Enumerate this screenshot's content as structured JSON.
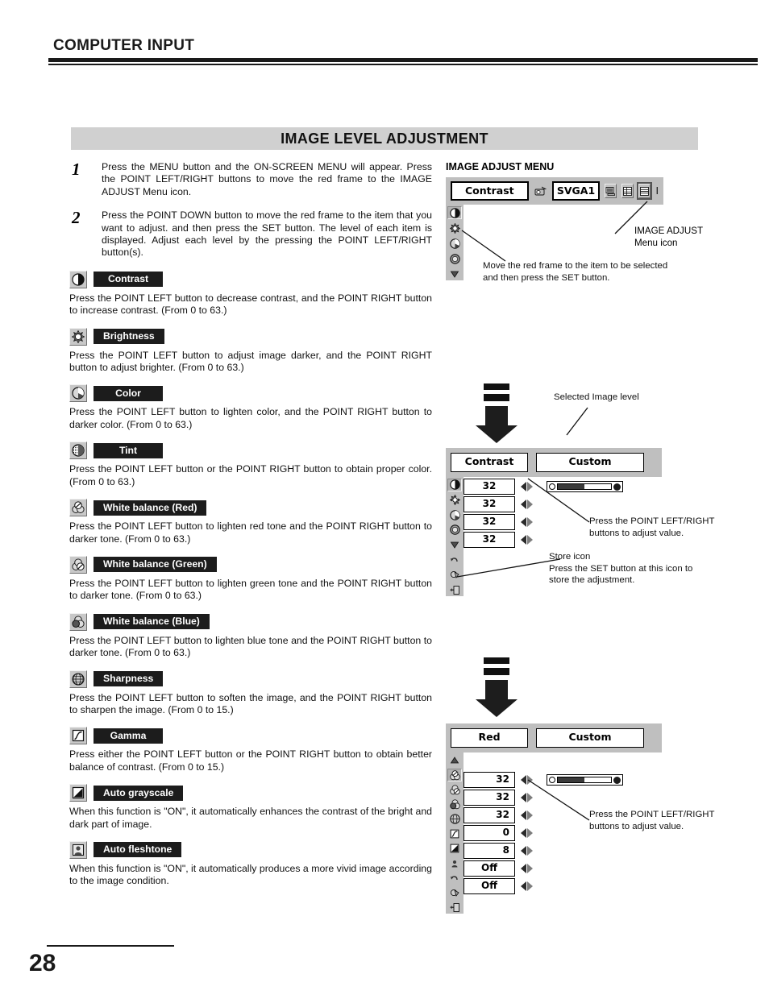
{
  "header": {
    "title": "COMPUTER INPUT"
  },
  "banner": {
    "title": "IMAGE LEVEL ADJUSTMENT"
  },
  "footer": {
    "page_number": "28"
  },
  "steps": [
    {
      "number": "1",
      "text": "Press the MENU button and the ON-SCREEN MENU will appear.  Press the POINT LEFT/RIGHT buttons to move the red frame to the IMAGE ADJUST Menu icon."
    },
    {
      "number": "2",
      "text": "Press the POINT DOWN button to move the red frame to the item that you want to adjust. and then press the SET button.  The level of each item is displayed.  Adjust each level by the pressing the POINT LEFT/RIGHT button(s)."
    }
  ],
  "items": [
    {
      "icon": "contrast-icon",
      "label": "Contrast",
      "description": "Press the POINT LEFT button to decrease contrast, and the POINT RIGHT button to increase contrast.  (From 0 to 63.)"
    },
    {
      "icon": "brightness-icon",
      "label": "Brightness",
      "description": "Press the POINT LEFT button to adjust image darker, and the POINT RIGHT button to adjust brighter.  (From 0 to 63.)"
    },
    {
      "icon": "color-icon",
      "label": "Color",
      "description": "Press the POINT LEFT button to lighten color, and the POINT RIGHT button to darker color.  (From 0 to 63.)"
    },
    {
      "icon": "tint-icon",
      "label": "Tint",
      "description": "Press the POINT LEFT button or the POINT RIGHT button to obtain proper color.  (From 0 to 63.)"
    },
    {
      "icon": "white-balance-red-icon",
      "label": "White balance (Red)",
      "description": "Press the POINT LEFT button to lighten red tone and the POINT RIGHT button to darker tone.  (From 0 to 63.)"
    },
    {
      "icon": "white-balance-green-icon",
      "label": "White balance (Green)",
      "description": "Press the POINT LEFT button to lighten green tone and the POINT RIGHT button to darker tone.  (From 0 to 63.)"
    },
    {
      "icon": "white-balance-blue-icon",
      "label": "White balance (Blue)",
      "description": "Press the POINT LEFT button to lighten blue tone and the POINT RIGHT button to darker tone.  (From 0 to 63.)"
    },
    {
      "icon": "sharpness-icon",
      "label": "Sharpness",
      "description": "Press the POINT LEFT button to soften the image, and the POINT RIGHT button to sharpen the image.  (From 0 to 15.)"
    },
    {
      "icon": "gamma-icon",
      "label": "Gamma",
      "description": "Press either the POINT LEFT button or the POINT RIGHT button to obtain better balance of contrast.  (From 0 to 15.)"
    },
    {
      "icon": "auto-grayscale-icon",
      "label": "Auto grayscale",
      "description": "When this function is \"ON\", it automatically enhances the contrast of the bright and dark part of image."
    },
    {
      "icon": "auto-fleshtone-icon",
      "label": "Auto fleshtone",
      "description": "When this function is \"ON\", it automatically produces a more vivid image according to the image condition."
    }
  ],
  "figure1": {
    "caption": "IMAGE ADJUST MENU",
    "menu_label": "Contrast",
    "input_value": "SVGA1",
    "toolbar_icons": [
      "projector-icon",
      "pc-system-icon",
      "image-select-icon",
      "image-adjust-icon"
    ],
    "selected_toolbar_icon": "image-adjust-icon",
    "sidebar_icons": [
      "contrast-icon",
      "brightness-icon",
      "color-icon",
      "tint-icon",
      "scroll-down-icon"
    ],
    "callout_menu_icon": "IMAGE ADJUST\nMenu icon",
    "callout_menu_icon_line1": "IMAGE ADJUST",
    "callout_menu_icon_line2": "Menu icon",
    "callout_red_frame": "Move the red frame to the item to be selected and then press the SET button."
  },
  "figure2": {
    "menu_label": "Contrast",
    "level_label": "Custom",
    "callout_level": "Selected Image level",
    "callout_adjust": "Press the POINT LEFT/RIGHT buttons to adjust value.",
    "callout_store_title": "Store icon",
    "callout_store_text": "Press the SET button at this icon to store the adjustment.",
    "rows": [
      {
        "icon": "contrast-icon",
        "value": "32",
        "selected": true
      },
      {
        "icon": "brightness-icon",
        "value": "32",
        "selected": false
      },
      {
        "icon": "color-icon",
        "value": "32",
        "selected": false
      },
      {
        "icon": "tint-icon",
        "value": "32",
        "selected": false
      }
    ],
    "extra_icons": [
      "scroll-down-icon",
      "reset-icon",
      "store-icon",
      "quit-icon"
    ],
    "slider_percent": 50
  },
  "figure3": {
    "menu_label": "Red",
    "level_label": "Custom",
    "callout_adjust": "Press the POINT LEFT/RIGHT buttons to adjust value.",
    "top_icon": "scroll-up-icon",
    "rows": [
      {
        "icon": "white-balance-red-icon",
        "value": "32",
        "align": "right",
        "selected": true
      },
      {
        "icon": "white-balance-green-icon",
        "value": "32",
        "align": "right",
        "selected": false
      },
      {
        "icon": "white-balance-blue-icon",
        "value": "32",
        "align": "right",
        "selected": false
      },
      {
        "icon": "sharpness-icon",
        "value": "0",
        "align": "right",
        "selected": false
      },
      {
        "icon": "gamma-icon",
        "value": "8",
        "align": "right",
        "selected": false
      },
      {
        "icon": "auto-grayscale-icon",
        "value": "Off",
        "align": "center",
        "selected": false
      },
      {
        "icon": "auto-fleshtone-icon",
        "value": "Off",
        "align": "center",
        "selected": false
      }
    ],
    "extra_icons": [
      "reset-icon",
      "store-icon",
      "quit-icon"
    ],
    "slider_percent": 50
  },
  "colors": {
    "banner_bg": "#d0d0d0",
    "label_bg": "#1c1c1c",
    "osd_bg": "#bfbfbf",
    "icon_bg": "#c8c8c8",
    "ink": "#1a1a1a"
  }
}
